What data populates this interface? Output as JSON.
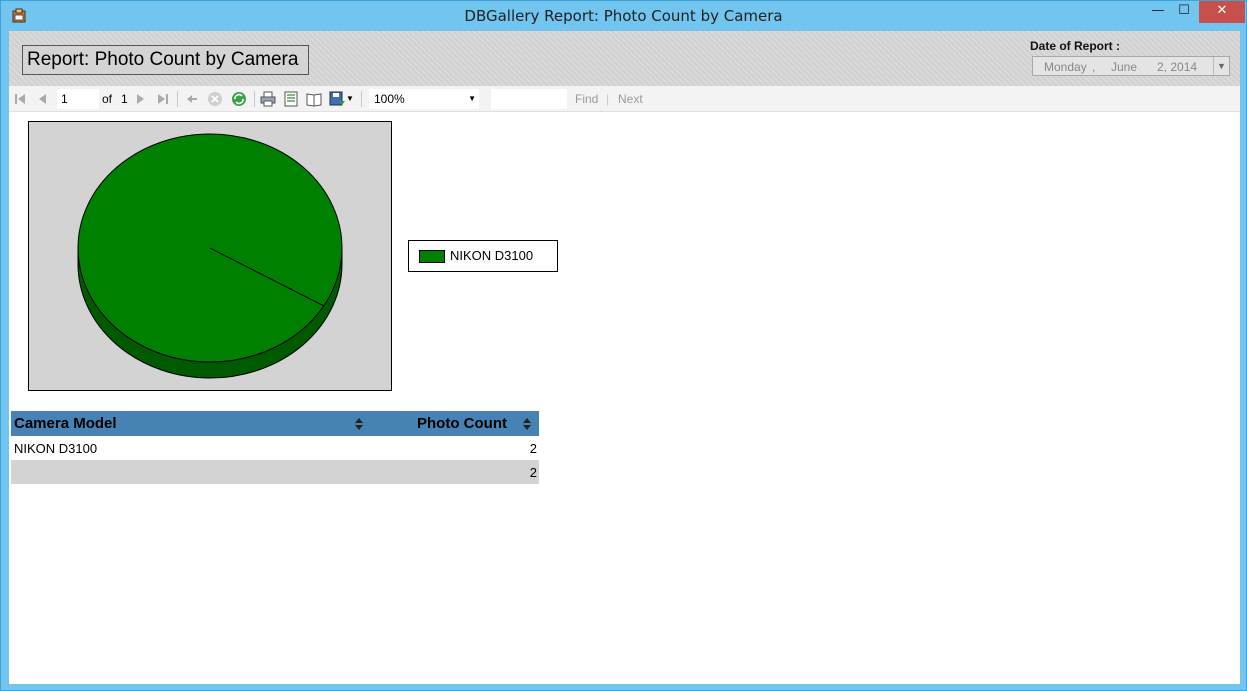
{
  "window": {
    "title": "DBGallery Report: Photo Count by Camera",
    "min_glyph": "—",
    "max_glyph": "☐",
    "close_glyph": "✕"
  },
  "header": {
    "report_title": "Report: Photo Count by Camera",
    "date_label": "Date of Report :",
    "date": {
      "weekday": "Monday",
      "sep": ",",
      "month": "June",
      "day_year": "2, 2014"
    }
  },
  "toolbar": {
    "current_page": "1",
    "of_label": "of",
    "total_pages": "1",
    "zoom": "100%",
    "find_label": "Find",
    "separator": "|",
    "next_label": "Next"
  },
  "legend": {
    "label": "NIKON D3100",
    "color": "#008000"
  },
  "chart_data": {
    "type": "pie",
    "categories": [
      "NIKON D3100"
    ],
    "values": [
      2
    ],
    "colors": [
      "#008000"
    ],
    "style": "3d",
    "legend_position": "right"
  },
  "table": {
    "columns": [
      "Camera Model",
      "Photo Count"
    ],
    "rows": [
      {
        "camera": "NIKON D3100",
        "count": "2"
      }
    ],
    "total": {
      "camera": "",
      "count": "2"
    }
  },
  "colors": {
    "header_bg": "#4682b4",
    "pie_fill": "#008000",
    "pie_side": "#005a00",
    "close_button": "#c7504d"
  }
}
